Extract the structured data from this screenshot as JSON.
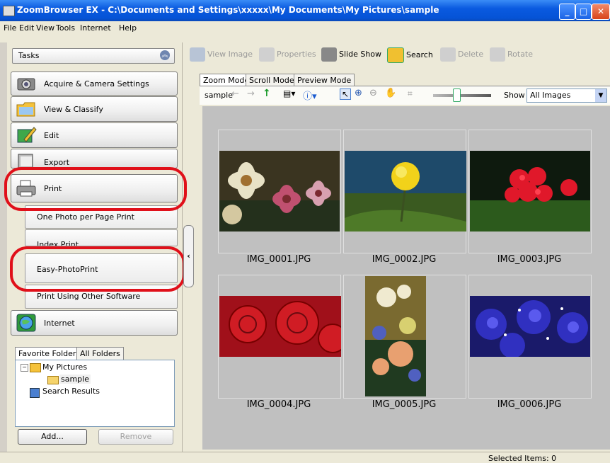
{
  "window": {
    "title": "ZoomBrowser EX  -  C:\\Documents and Settings\\xxxxx\\My Documents\\My Pictures\\sample"
  },
  "menu": [
    "File",
    "Edit",
    "View",
    "Tools",
    "Internet",
    "Help"
  ],
  "tasks": {
    "header": "Tasks",
    "items": [
      {
        "label": "Acquire & Camera Settings",
        "icon": "camera-icon"
      },
      {
        "label": "View & Classify",
        "icon": "folder-icon"
      },
      {
        "label": "Edit",
        "icon": "edit-pencil-icon"
      },
      {
        "label": "Export",
        "icon": "export-icon"
      },
      {
        "label": "Print",
        "icon": "printer-icon"
      }
    ],
    "print_sub": [
      "One Photo per Page Print",
      "Index Print",
      "Easy-PhotoPrint",
      "Print Using Other Software"
    ],
    "internet": {
      "label": "Internet",
      "icon": "globe-icon"
    }
  },
  "folders": {
    "tabs": [
      "Favorite Folders",
      "All Folders"
    ],
    "tree": [
      "My Pictures",
      "sample",
      "Search Results"
    ],
    "add_label": "Add...",
    "remove_label": "Remove"
  },
  "toolbar": [
    "View Image",
    "Properties",
    "Slide Show",
    "Search",
    "Delete",
    "Rotate"
  ],
  "view_tabs": [
    "Zoom Mode",
    "Scroll Mode",
    "Preview Mode"
  ],
  "viewbar": {
    "folder": "sample",
    "show_label": "Show",
    "show_value": "All Images"
  },
  "thumbnails": [
    "IMG_0001.JPG",
    "IMG_0002.JPG",
    "IMG_0003.JPG",
    "IMG_0004.JPG",
    "IMG_0005.JPG",
    "IMG_0006.JPG"
  ],
  "status": {
    "selected": "Selected Items: 0"
  },
  "colors": {
    "highlight": "#e0101a",
    "titlebar": "#0a5ae0",
    "viewarea": "#c0c0c0"
  }
}
